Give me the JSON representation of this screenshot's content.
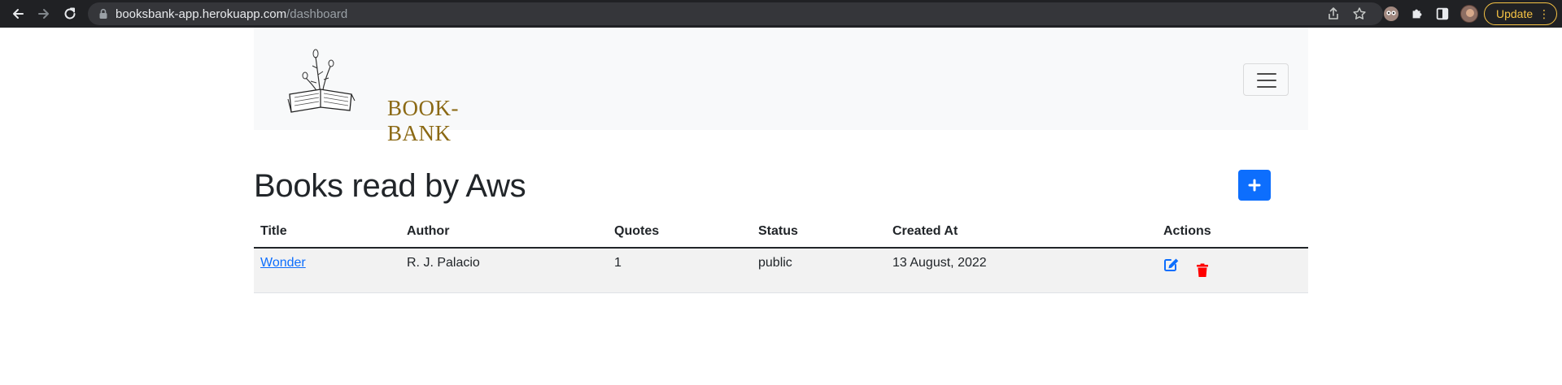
{
  "browser": {
    "url_host": "booksbank-app.herokuapp.com",
    "url_path": "/dashboard",
    "update_label": "Update",
    "menu_glyph": "⋮"
  },
  "navbar": {
    "brand": "BOOK-BANK",
    "logo_icon": "book-flower-icon",
    "toggler_icon": "hamburger-menu-icon"
  },
  "main": {
    "title": "Books read by Aws",
    "add_icon": "plus-icon",
    "accent_color": "#0d6efd",
    "danger_color": "#ff0000"
  },
  "table": {
    "headers": [
      "Title",
      "Author",
      "Quotes",
      "Status",
      "Created At",
      "Actions"
    ],
    "rows": [
      {
        "title": "Wonder",
        "author": "R. J. Palacio",
        "quotes": "1",
        "status": "public",
        "created_at": "13 August, 2022",
        "actions": [
          "edit-icon",
          "trash-icon"
        ]
      }
    ]
  }
}
